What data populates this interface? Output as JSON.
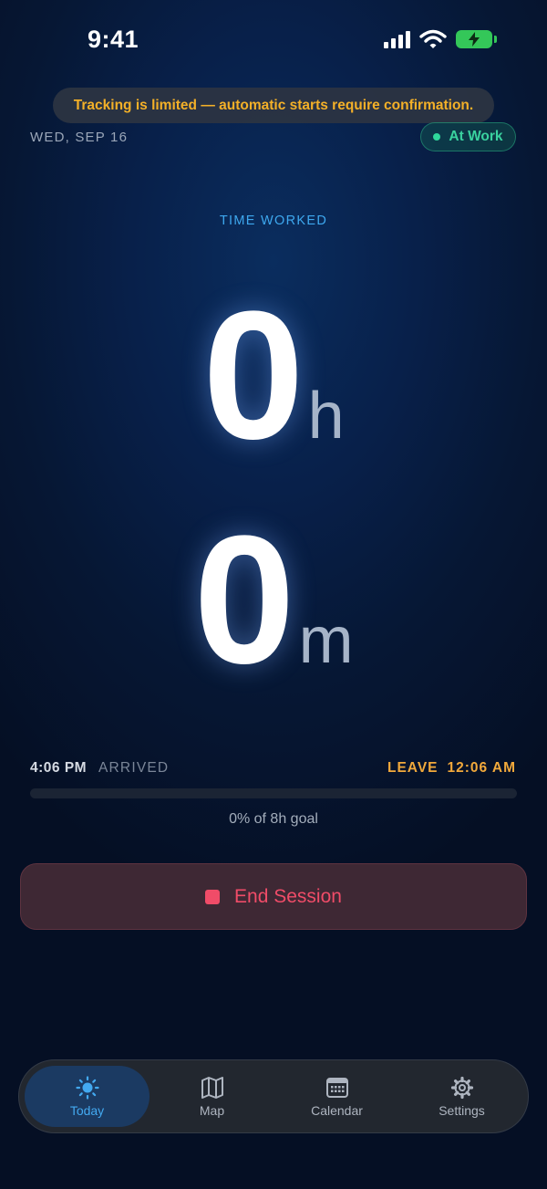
{
  "status_bar": {
    "time": "9:41"
  },
  "banner": {
    "text": "Tracking is limited — automatic starts require confirmation."
  },
  "header": {
    "date": "WED, SEP 16",
    "status_badge": "At Work"
  },
  "timer": {
    "label": "TIME WORKED",
    "hours": "0",
    "hours_unit": "h",
    "minutes": "0",
    "minutes_unit": "m"
  },
  "session": {
    "arrived_time": "4:06 PM",
    "arrived_label": "ARRIVED",
    "leave_label": "LEAVE",
    "leave_time": "12:06 AM",
    "progress_percent": 0,
    "goal_text": "0% of 8h goal"
  },
  "end_button": {
    "label": "End Session"
  },
  "tabs": [
    {
      "label": "Today",
      "icon": "sun-icon",
      "active": true
    },
    {
      "label": "Map",
      "icon": "map-icon",
      "active": false
    },
    {
      "label": "Calendar",
      "icon": "calendar-icon",
      "active": false
    },
    {
      "label": "Settings",
      "icon": "gear-icon",
      "active": false
    }
  ],
  "colors": {
    "accent": "#3ea8ef",
    "warning": "#f2a93b",
    "success": "#3ad29f",
    "danger": "#f04c68"
  }
}
